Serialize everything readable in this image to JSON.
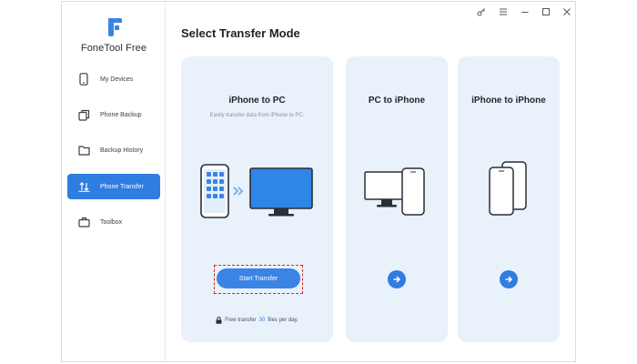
{
  "app": {
    "name": "FoneTool Free",
    "accent": "#2f7de1"
  },
  "titlebar": {
    "icons": [
      "key-icon",
      "menu-icon",
      "minimize-icon",
      "maximize-icon",
      "close-icon"
    ]
  },
  "sidebar": {
    "items": [
      {
        "label": "My Devices",
        "icon": "phone-icon",
        "active": false
      },
      {
        "label": "Phone Backup",
        "icon": "backup-icon",
        "active": false
      },
      {
        "label": "Backup History",
        "icon": "folder-icon",
        "active": false
      },
      {
        "label": "Phone Transfer",
        "icon": "transfer-icon",
        "active": true
      },
      {
        "label": "Toolbox",
        "icon": "toolbox-icon",
        "active": false
      }
    ]
  },
  "main": {
    "title": "Select Transfer Mode",
    "cards": [
      {
        "title": "iPhone to PC",
        "subtitle": "Easily transfer data from iPhone to PC.",
        "button_label": "Start Transfer",
        "free_prefix": "Free transfer",
        "free_count": "30",
        "free_suffix": "files per day."
      },
      {
        "title": "PC to iPhone"
      },
      {
        "title": "iPhone to iPhone"
      }
    ]
  }
}
